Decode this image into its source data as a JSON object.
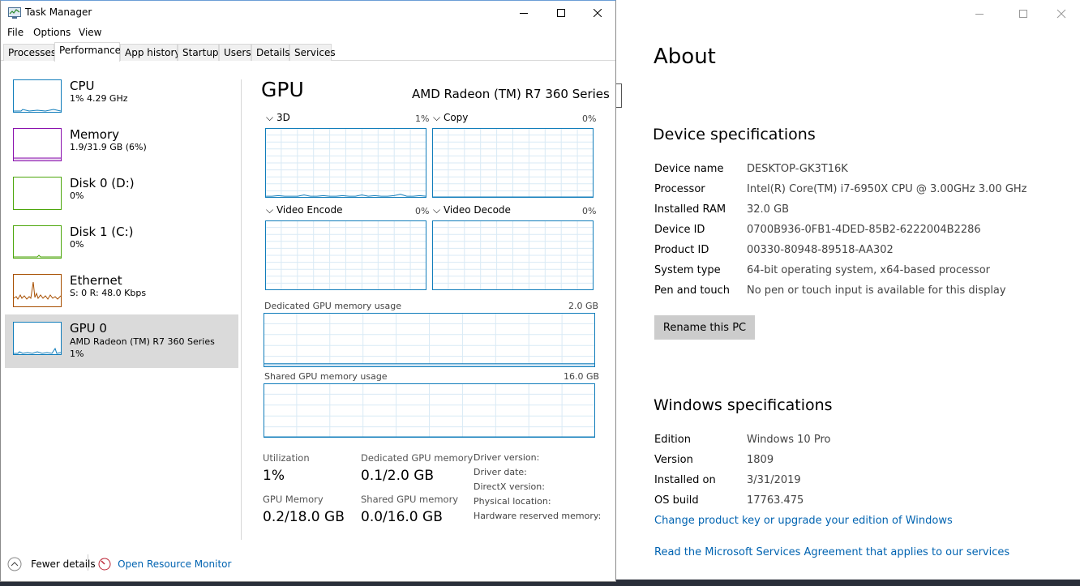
{
  "task_manager": {
    "title": "Task Manager",
    "menu": [
      "File",
      "Options",
      "View"
    ],
    "tabs": [
      "Processes",
      "Performance",
      "App history",
      "Startup",
      "Users",
      "Details",
      "Services"
    ],
    "active_tab": "Performance",
    "sidebar": [
      {
        "name": "CPU",
        "sub": "1% 4.29 GHz",
        "color": "#117dbb"
      },
      {
        "name": "Memory",
        "sub": "1.9/31.9 GB (6%)",
        "color": "#8b12ae"
      },
      {
        "name": "Disk 0 (D:)",
        "sub": "0%",
        "color": "#4da60c"
      },
      {
        "name": "Disk 1 (C:)",
        "sub": "0%",
        "color": "#4da60c"
      },
      {
        "name": "Ethernet",
        "sub": "S: 0 R: 48.0 Kbps",
        "color": "#a74f01"
      },
      {
        "name": "GPU 0",
        "sub": "AMD Radeon (TM) R7 360 Series",
        "sub2": "1%",
        "color": "#117dbb",
        "selected": true
      }
    ],
    "gpu": {
      "heading": "GPU",
      "model": "AMD Radeon (TM) R7 360 Series",
      "engines": [
        {
          "name": "3D",
          "pct": "1%"
        },
        {
          "name": "Copy",
          "pct": "0%"
        },
        {
          "name": "Video Encode",
          "pct": "0%"
        },
        {
          "name": "Video Decode",
          "pct": "0%"
        }
      ],
      "dedicated_label": "Dedicated GPU memory usage",
      "dedicated_max": "2.0 GB",
      "shared_label": "Shared GPU memory usage",
      "shared_max": "16.0 GB",
      "stats": {
        "utilization_label": "Utilization",
        "utilization": "1%",
        "dedicated_label": "Dedicated GPU memory",
        "dedicated": "0.1/2.0 GB",
        "gpu_memory_label": "GPU Memory",
        "gpu_memory": "0.2/18.0 GB",
        "shared_label": "Shared GPU memory",
        "shared": "0.0/16.0 GB"
      },
      "driver_info": [
        "Driver version:",
        "Driver date:",
        "DirectX version:",
        "Physical location:",
        "Hardware reserved memory:"
      ]
    },
    "fewer_details": "Fewer details",
    "open_resource_monitor": "Open Resource Monitor"
  },
  "about": {
    "title": "About",
    "device_heading": "Device specifications",
    "device": [
      {
        "label": "Device name",
        "value": "DESKTOP-GK3T16K"
      },
      {
        "label": "Processor",
        "value": "Intel(R) Core(TM) i7-6950X CPU @ 3.00GHz   3.00 GHz"
      },
      {
        "label": "Installed RAM",
        "value": "32.0 GB"
      },
      {
        "label": "Device ID",
        "value": "0700B936-0FB1-4DED-85B2-6222004B2286"
      },
      {
        "label": "Product ID",
        "value": "00330-80948-89518-AA302"
      },
      {
        "label": "System type",
        "value": "64-bit operating system, x64-based processor"
      },
      {
        "label": "Pen and touch",
        "value": "No pen or touch input is available for this display"
      }
    ],
    "rename_button": "Rename this PC",
    "windows_heading": "Windows specifications",
    "windows": [
      {
        "label": "Edition",
        "value": "Windows 10 Pro"
      },
      {
        "label": "Version",
        "value": "1809"
      },
      {
        "label": "Installed on",
        "value": "3/31/2019"
      },
      {
        "label": "OS build",
        "value": "17763.475"
      }
    ],
    "link_product_key": "Change product key or upgrade your edition of Windows",
    "link_services_agreement": "Read the Microsoft Services Agreement that applies to our services"
  },
  "chart_data": [
    {
      "type": "line",
      "title": "3D",
      "ylim": [
        0,
        100
      ],
      "series": [
        {
          "values": [
            1,
            1,
            2,
            1,
            1,
            1,
            3,
            1,
            1,
            2,
            1,
            1,
            2,
            1,
            1,
            3,
            1,
            2,
            1,
            1,
            2,
            4,
            1,
            1,
            2,
            1
          ]
        }
      ]
    },
    {
      "type": "line",
      "title": "Copy",
      "ylim": [
        0,
        100
      ],
      "series": [
        {
          "values": [
            0,
            0,
            0,
            0,
            0,
            0,
            0,
            0,
            0,
            0,
            0,
            0,
            0,
            0,
            0,
            0,
            0,
            0,
            0,
            0,
            0,
            0,
            0,
            0,
            0,
            0
          ]
        }
      ]
    },
    {
      "type": "area",
      "title": "Dedicated GPU memory usage",
      "ylim": [
        0,
        2.0
      ],
      "series": [
        {
          "values": [
            0.1,
            0.1,
            0.1,
            0.1,
            0.1,
            0.1,
            0.1,
            0.1
          ]
        }
      ]
    },
    {
      "type": "area",
      "title": "Shared GPU memory usage",
      "ylim": [
        0,
        16.0
      ],
      "series": [
        {
          "values": [
            0.0,
            0.0,
            0.0,
            0.0,
            0.0,
            0.0,
            0.0,
            0.0
          ]
        }
      ]
    }
  ]
}
